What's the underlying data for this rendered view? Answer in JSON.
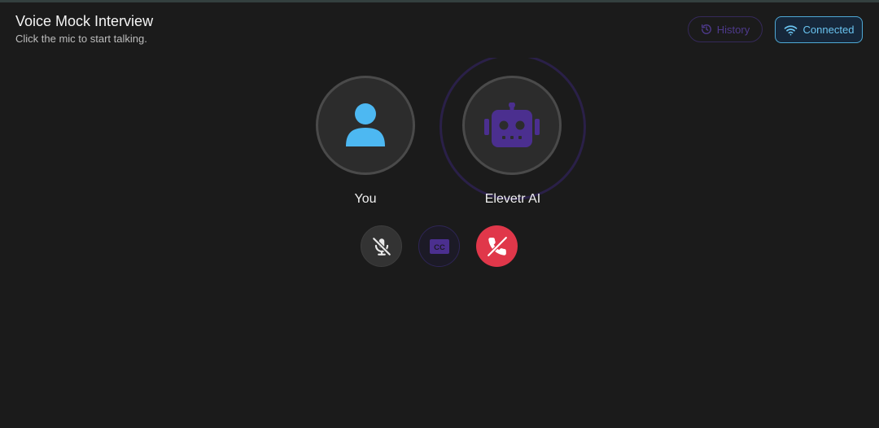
{
  "header": {
    "title": "Voice Mock Interview",
    "subtitle": "Click the mic to start talking."
  },
  "toolbar": {
    "history_label": "History",
    "connected_label": "Connected"
  },
  "participants": {
    "you": {
      "name": "You",
      "icon": "user-icon"
    },
    "ai": {
      "name": "Elevetr AI",
      "icon": "robot-icon"
    }
  },
  "controls": {
    "mic": {
      "icon": "mic-off-icon",
      "state": "muted"
    },
    "cc": {
      "icon": "captions-icon",
      "text": "CC"
    },
    "end": {
      "icon": "end-call-icon"
    }
  },
  "colors": {
    "accent_purple": "#4e3a8c",
    "accent_blue": "#4fb8ef",
    "end_red": "#e0374a",
    "background": "#1b1b1b"
  }
}
